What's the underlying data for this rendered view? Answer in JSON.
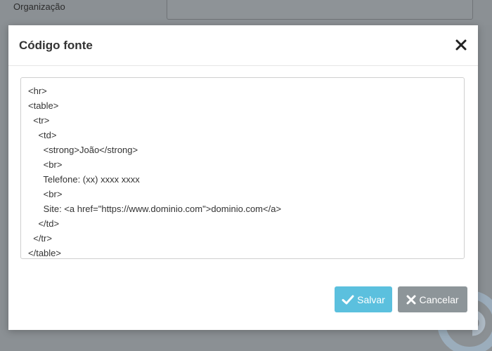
{
  "background": {
    "field_label": "Organização"
  },
  "modal": {
    "title": "Código fonte",
    "code_lines": [
      "<hr>",
      "<table>",
      "  <tr>",
      "    <td>",
      "      <strong>João</strong>",
      "      <br>",
      "      Telefone: (xx) xxxx xxxx",
      "      <br>",
      "      Site: <a href=\"https://www.dominio.com\">dominio.com</a>",
      "    </td>",
      "  </tr>",
      "</table>"
    ],
    "buttons": {
      "save_label": "Salvar",
      "cancel_label": "Cancelar"
    }
  },
  "icons": {
    "close": "close-icon",
    "save": "check-icon",
    "cancel": "x-icon"
  },
  "colors": {
    "save_button": "#5bc0de",
    "cancel_button": "#8d9599",
    "overlay": "#8a8f93"
  }
}
